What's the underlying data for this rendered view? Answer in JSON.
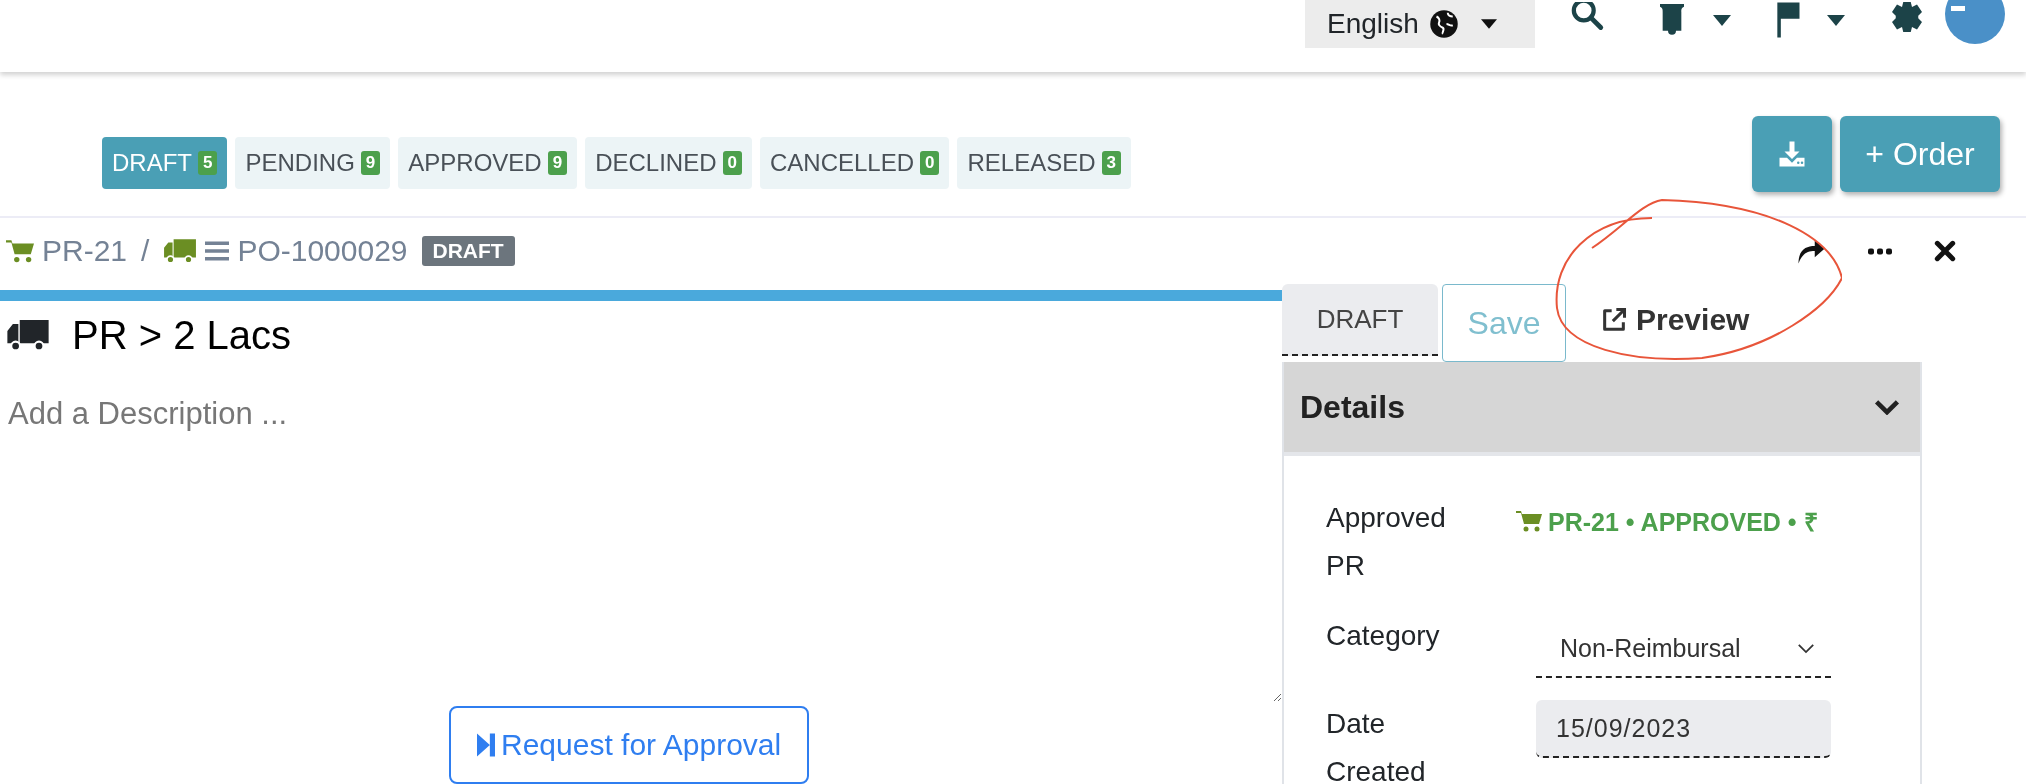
{
  "top_bar": {
    "language": "English"
  },
  "status_tabs": [
    {
      "label": "DRAFT",
      "count": "5",
      "selected": true
    },
    {
      "label": "PENDING",
      "count": "9",
      "selected": false
    },
    {
      "label": "APPROVED",
      "count": "9",
      "selected": false
    },
    {
      "label": "DECLINED",
      "count": "0",
      "selected": false
    },
    {
      "label": "CANCELLED",
      "count": "0",
      "selected": false
    },
    {
      "label": "RELEASED",
      "count": "3",
      "selected": false
    }
  ],
  "order_button": "+ Order",
  "breadcrumb": {
    "pr": "PR-21",
    "separator": "/",
    "po": "PO-1000029",
    "badge": "DRAFT"
  },
  "title": "PR > 2 Lacs",
  "description": {
    "placeholder": "Add a Description ..."
  },
  "request_button": "Request for Approval",
  "panel": {
    "tabs": [
      {
        "kind": "status",
        "label": "DRAFT"
      },
      {
        "kind": "save",
        "label": "Save"
      },
      {
        "kind": "preview",
        "label": "Preview"
      }
    ],
    "section": {
      "title": "Details",
      "expanded": true
    },
    "fields": [
      {
        "kind": "link",
        "label": "Approved PR",
        "value": "PR-21 • APPROVED • ₹"
      },
      {
        "kind": "select",
        "label": "Category",
        "value": "Non-Reimbursal"
      },
      {
        "kind": "date",
        "label": "Date Created",
        "value": "15/09/2023"
      }
    ]
  }
}
